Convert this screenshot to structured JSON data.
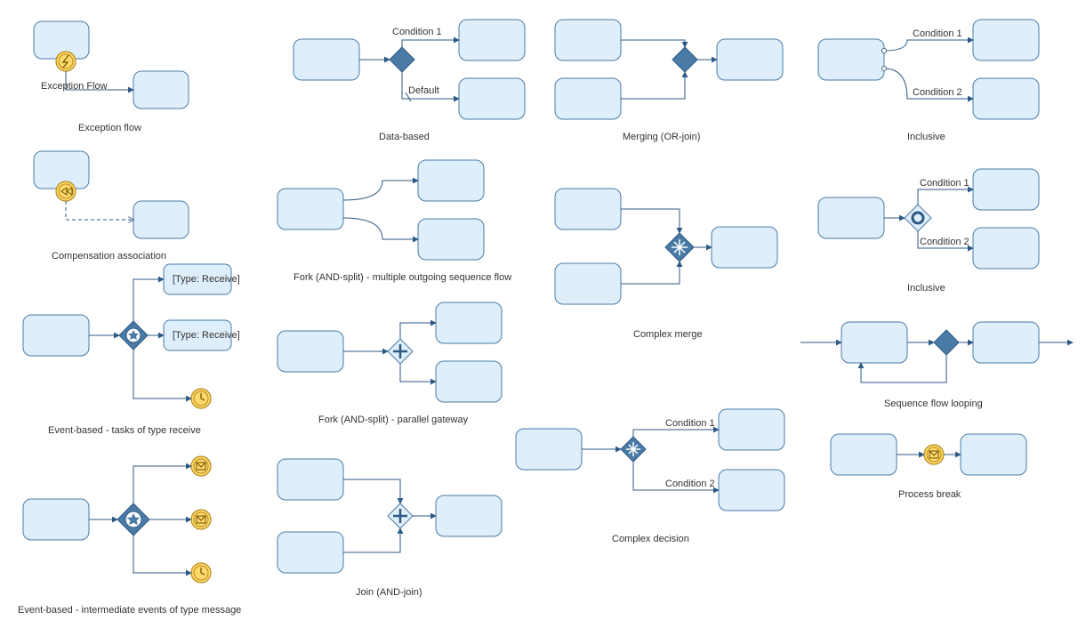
{
  "colors": {
    "taskFill": "#dfeefb",
    "taskStroke": "#4a7ba6",
    "gateway": "#4a7ba6",
    "flow": "#2d5a85",
    "eventFill": "#ffd96a",
    "eventStroke": "#b58a1e"
  },
  "labels": {
    "exceptionFlowEdge": "Exception Flow",
    "exceptionFlow": "Exception flow",
    "compensationAssoc": "Compensation association",
    "eventBasedTasks": "Event-based - tasks of type receive",
    "eventBasedMsg": "Event-based - intermediate events of type message",
    "dataBased": "Data-based",
    "forkMulti": "Fork (AND-split) - multiple outgoing sequence flow",
    "forkParallel": "Fork (AND-split) - parallel gateway",
    "join": "Join (AND-join)",
    "merging": "Merging (OR-join)",
    "complexMerge": "Complex merge",
    "complexDecision": "Complex decision",
    "inclusive1": "Inclusive",
    "inclusive2": "Inclusive",
    "seqLoop": "Sequence flow looping",
    "processBreak": "Process break",
    "condition1": "Condition 1",
    "condition2": "Condition 2",
    "default": "Default",
    "typeReceive1": "[Type: Receive]",
    "typeReceive2": "[Type: Receive]"
  },
  "diagrams": [
    "Exception flow",
    "Compensation association",
    "Event-based - tasks of type receive",
    "Event-based - intermediate events of type message",
    "Data-based",
    "Fork (AND-split) - multiple outgoing sequence flow",
    "Fork (AND-split) - parallel gateway",
    "Join (AND-join)",
    "Merging (OR-join)",
    "Complex merge",
    "Complex decision",
    "Inclusive (diamond)",
    "Inclusive (circle)",
    "Sequence flow looping",
    "Process break"
  ]
}
